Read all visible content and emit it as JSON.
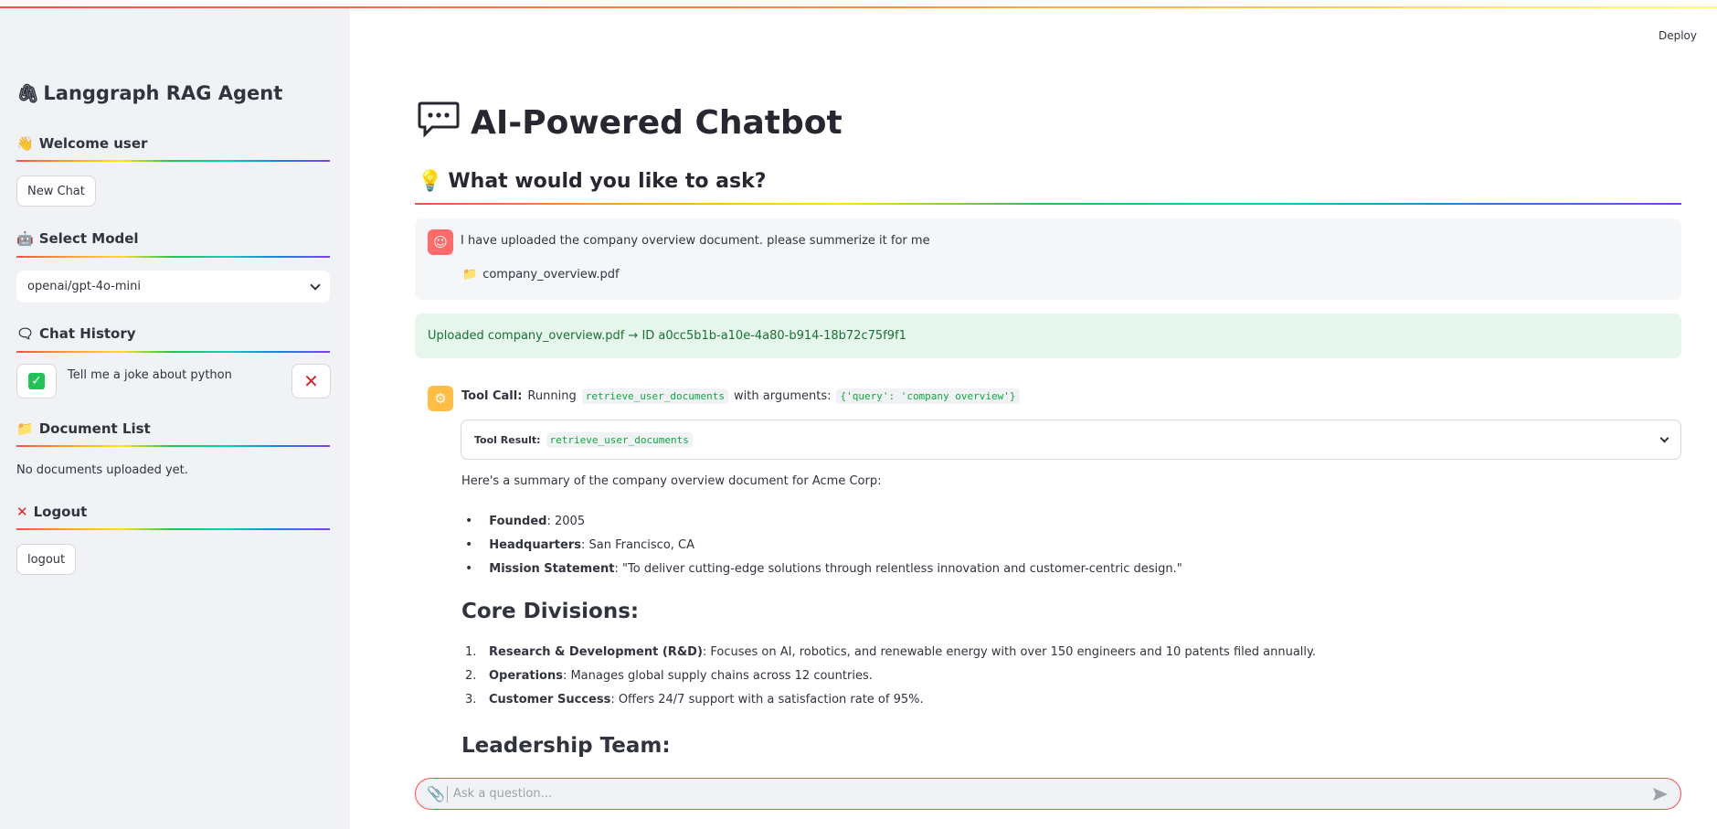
{
  "app": {
    "deploy_label": "Deploy"
  },
  "sidebar": {
    "title": "Langgraph RAG Agent",
    "welcome": "Welcome user",
    "new_chat_label": "New Chat",
    "select_model_header": "Select Model",
    "model_selected": "openai/gpt-4o-mini",
    "chat_history_header": "Chat History",
    "history_items": [
      {
        "label": "Tell me a joke about python"
      }
    ],
    "document_list_header": "Document List",
    "no_documents_text": "No documents uploaded yet.",
    "logout_header": "Logout",
    "logout_label": "logout"
  },
  "main": {
    "title": "AI-Powered Chatbot",
    "subtitle": "What would you like to ask?",
    "user_message": "I have uploaded the company overview document. please summerize it for me",
    "user_file": "company_overview.pdf",
    "upload_success": "Uploaded company_overview.pdf → ID a0cc5b1b-a10e-4a80-b914-18b72c75f9f1",
    "tool_call_label": "Tool Call:",
    "tool_running": "Running",
    "tool_name": "retrieve_user_documents",
    "tool_with_args": "with arguments:",
    "tool_args": "{'query': 'company overview'}",
    "tool_result_label": "Tool Result:",
    "tool_result_name": "retrieve_user_documents",
    "summary_intro": "Here's a summary of the company overview document for Acme Corp:",
    "facts": [
      {
        "key": "Founded",
        "value": ": 2005"
      },
      {
        "key": "Headquarters",
        "value": ": San Francisco, CA"
      },
      {
        "key": "Mission Statement",
        "value": ": \"To deliver cutting-edge solutions through relentless innovation and customer-centric design.\""
      }
    ],
    "core_divisions_heading": "Core Divisions:",
    "divisions": [
      {
        "num": "1.",
        "key": "Research & Development (R&D)",
        "value": ": Focuses on AI, robotics, and renewable energy with over 150 engineers and 10 patents filed annually."
      },
      {
        "num": "2.",
        "key": "Operations",
        "value": ": Manages global supply chains across 12 countries."
      },
      {
        "num": "3.",
        "key": "Customer Success",
        "value": ": Offers 24/7 support with a satisfaction rate of 95%."
      }
    ],
    "leadership_heading": "Leadership Team:"
  },
  "chat_input": {
    "placeholder": "Ask a question..."
  }
}
